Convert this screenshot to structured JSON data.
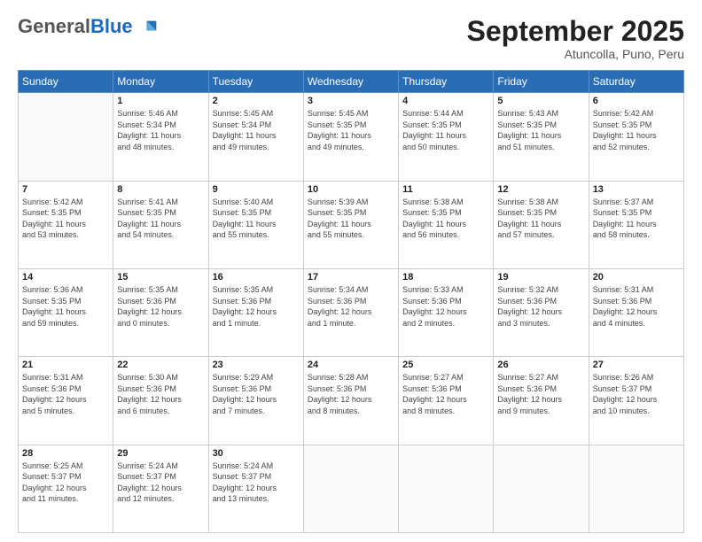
{
  "header": {
    "logo_general": "General",
    "logo_blue": "Blue",
    "month_title": "September 2025",
    "location": "Atuncolla, Puno, Peru"
  },
  "weekdays": [
    "Sunday",
    "Monday",
    "Tuesday",
    "Wednesday",
    "Thursday",
    "Friday",
    "Saturday"
  ],
  "weeks": [
    [
      {
        "day": "",
        "info": ""
      },
      {
        "day": "1",
        "info": "Sunrise: 5:46 AM\nSunset: 5:34 PM\nDaylight: 11 hours\nand 48 minutes."
      },
      {
        "day": "2",
        "info": "Sunrise: 5:45 AM\nSunset: 5:34 PM\nDaylight: 11 hours\nand 49 minutes."
      },
      {
        "day": "3",
        "info": "Sunrise: 5:45 AM\nSunset: 5:35 PM\nDaylight: 11 hours\nand 49 minutes."
      },
      {
        "day": "4",
        "info": "Sunrise: 5:44 AM\nSunset: 5:35 PM\nDaylight: 11 hours\nand 50 minutes."
      },
      {
        "day": "5",
        "info": "Sunrise: 5:43 AM\nSunset: 5:35 PM\nDaylight: 11 hours\nand 51 minutes."
      },
      {
        "day": "6",
        "info": "Sunrise: 5:42 AM\nSunset: 5:35 PM\nDaylight: 11 hours\nand 52 minutes."
      }
    ],
    [
      {
        "day": "7",
        "info": "Sunrise: 5:42 AM\nSunset: 5:35 PM\nDaylight: 11 hours\nand 53 minutes."
      },
      {
        "day": "8",
        "info": "Sunrise: 5:41 AM\nSunset: 5:35 PM\nDaylight: 11 hours\nand 54 minutes."
      },
      {
        "day": "9",
        "info": "Sunrise: 5:40 AM\nSunset: 5:35 PM\nDaylight: 11 hours\nand 55 minutes."
      },
      {
        "day": "10",
        "info": "Sunrise: 5:39 AM\nSunset: 5:35 PM\nDaylight: 11 hours\nand 55 minutes."
      },
      {
        "day": "11",
        "info": "Sunrise: 5:38 AM\nSunset: 5:35 PM\nDaylight: 11 hours\nand 56 minutes."
      },
      {
        "day": "12",
        "info": "Sunrise: 5:38 AM\nSunset: 5:35 PM\nDaylight: 11 hours\nand 57 minutes."
      },
      {
        "day": "13",
        "info": "Sunrise: 5:37 AM\nSunset: 5:35 PM\nDaylight: 11 hours\nand 58 minutes."
      }
    ],
    [
      {
        "day": "14",
        "info": "Sunrise: 5:36 AM\nSunset: 5:35 PM\nDaylight: 11 hours\nand 59 minutes."
      },
      {
        "day": "15",
        "info": "Sunrise: 5:35 AM\nSunset: 5:36 PM\nDaylight: 12 hours\nand 0 minutes."
      },
      {
        "day": "16",
        "info": "Sunrise: 5:35 AM\nSunset: 5:36 PM\nDaylight: 12 hours\nand 1 minute."
      },
      {
        "day": "17",
        "info": "Sunrise: 5:34 AM\nSunset: 5:36 PM\nDaylight: 12 hours\nand 1 minute."
      },
      {
        "day": "18",
        "info": "Sunrise: 5:33 AM\nSunset: 5:36 PM\nDaylight: 12 hours\nand 2 minutes."
      },
      {
        "day": "19",
        "info": "Sunrise: 5:32 AM\nSunset: 5:36 PM\nDaylight: 12 hours\nand 3 minutes."
      },
      {
        "day": "20",
        "info": "Sunrise: 5:31 AM\nSunset: 5:36 PM\nDaylight: 12 hours\nand 4 minutes."
      }
    ],
    [
      {
        "day": "21",
        "info": "Sunrise: 5:31 AM\nSunset: 5:36 PM\nDaylight: 12 hours\nand 5 minutes."
      },
      {
        "day": "22",
        "info": "Sunrise: 5:30 AM\nSunset: 5:36 PM\nDaylight: 12 hours\nand 6 minutes."
      },
      {
        "day": "23",
        "info": "Sunrise: 5:29 AM\nSunset: 5:36 PM\nDaylight: 12 hours\nand 7 minutes."
      },
      {
        "day": "24",
        "info": "Sunrise: 5:28 AM\nSunset: 5:36 PM\nDaylight: 12 hours\nand 8 minutes."
      },
      {
        "day": "25",
        "info": "Sunrise: 5:27 AM\nSunset: 5:36 PM\nDaylight: 12 hours\nand 8 minutes."
      },
      {
        "day": "26",
        "info": "Sunrise: 5:27 AM\nSunset: 5:36 PM\nDaylight: 12 hours\nand 9 minutes."
      },
      {
        "day": "27",
        "info": "Sunrise: 5:26 AM\nSunset: 5:37 PM\nDaylight: 12 hours\nand 10 minutes."
      }
    ],
    [
      {
        "day": "28",
        "info": "Sunrise: 5:25 AM\nSunset: 5:37 PM\nDaylight: 12 hours\nand 11 minutes."
      },
      {
        "day": "29",
        "info": "Sunrise: 5:24 AM\nSunset: 5:37 PM\nDaylight: 12 hours\nand 12 minutes."
      },
      {
        "day": "30",
        "info": "Sunrise: 5:24 AM\nSunset: 5:37 PM\nDaylight: 12 hours\nand 13 minutes."
      },
      {
        "day": "",
        "info": ""
      },
      {
        "day": "",
        "info": ""
      },
      {
        "day": "",
        "info": ""
      },
      {
        "day": "",
        "info": ""
      }
    ]
  ]
}
